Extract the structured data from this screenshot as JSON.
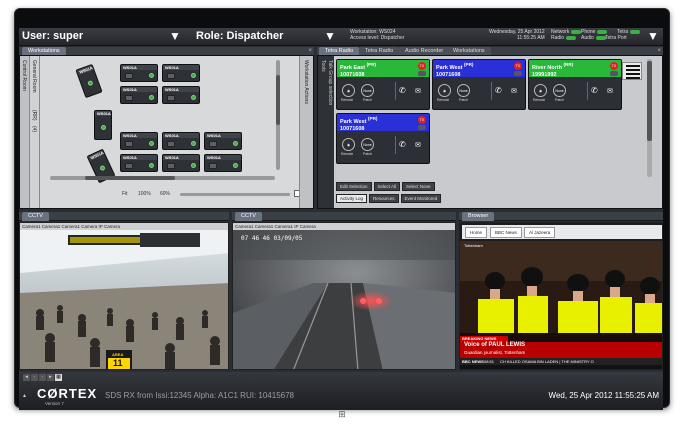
{
  "topbar": {
    "user_label": "User: super",
    "role_label": "Role: Dispatcher",
    "workstation": "Workstation: WS024",
    "access": "Access level: Dispatcher",
    "date_line": "Wednesday, 25 Apr 2012",
    "time_line": "11:55:25 AM",
    "status": [
      {
        "label": "Network"
      },
      {
        "label": "Phone"
      },
      {
        "label": "Tetra"
      },
      {
        "label": "Radio"
      },
      {
        "label": "Audio"
      },
      {
        "label": "Tetra Port"
      }
    ]
  },
  "workstations": {
    "tab": "Workstations",
    "side_labels": [
      "Control Room",
      "General Room",
      "(RR)",
      "(4)"
    ],
    "actions_label": "Workstation Actions",
    "tiles": [
      "WS01A",
      "WS01A",
      "WS01A",
      "WS01A",
      "WS01A",
      "WS01A",
      "WS01A",
      "WS01A",
      "WS01A",
      "WS01A",
      "WS01A"
    ],
    "zoom": {
      "fit": "Fit",
      "pct1": "100%",
      "pct2": "60%"
    }
  },
  "tetra": {
    "tabs": [
      "Tetra Radio",
      "Tetra Radio",
      "Audio Recorder",
      "Workstations"
    ],
    "side_labels": [
      "Talk Group selection",
      "Tools"
    ],
    "cards": [
      {
        "title": "Park East",
        "tag": "(PR)",
        "number": "10071608",
        "color": "#28b83a",
        "tx": "TX"
      },
      {
        "title": "Park West",
        "tag": "(PR)",
        "number": "10071608",
        "color": "#2a30d8",
        "tx": "TX"
      },
      {
        "title": "River North",
        "tag": "(RR)",
        "number": "19991992",
        "color": "#28b83a",
        "tx": "TX"
      },
      {
        "title": "Park West",
        "tag": "(PR)",
        "number": "10071608",
        "color": "#2a30d8",
        "tx": "TX"
      }
    ],
    "card_buttons": [
      "Remote",
      "Patch"
    ],
    "footer_buttons": [
      "Edit Selection",
      "Select All",
      "Select None"
    ],
    "bottom_tabs": [
      "Activity Log",
      "Resources",
      "Event Monitored"
    ]
  },
  "cctv1": {
    "tab": "CCTV",
    "caption": "Camera1 Camera1 Camera1 Camera IP Camera",
    "platform_sign": "AREA",
    "platform_no": "11"
  },
  "cctv2": {
    "tab": "CCTV",
    "caption": "Camera1 Camera1 Camera1 IP Camera",
    "timestamp": "07 46 46  03/09/05"
  },
  "browser": {
    "tab": "Browser",
    "nav": [
      "Home",
      "BBC News",
      "Al Jazeera"
    ],
    "breaking": "BREAKING NEWS",
    "headline": "Voice of PAUL LEWIS",
    "subhead": "Guardian journalist, Tottenham",
    "ticker": "CH KILLED OSAMA BIN LADEN  |  THE MINISTRY O",
    "channel": "BBC NEWS",
    "time": "08:51",
    "station": "Tottenham"
  },
  "bottom": {
    "logo": "CØRTEX",
    "version": "Version 7",
    "sds": "SDS RX from Issi:12345 Alpha: A1C1 RUI: 10415678",
    "clock": "Wed, 25 Apr 2012 11:55:25 AM"
  },
  "colors": {
    "green": "#28b83a",
    "blue": "#2a30d8",
    "tx_red": "#dd2222"
  }
}
